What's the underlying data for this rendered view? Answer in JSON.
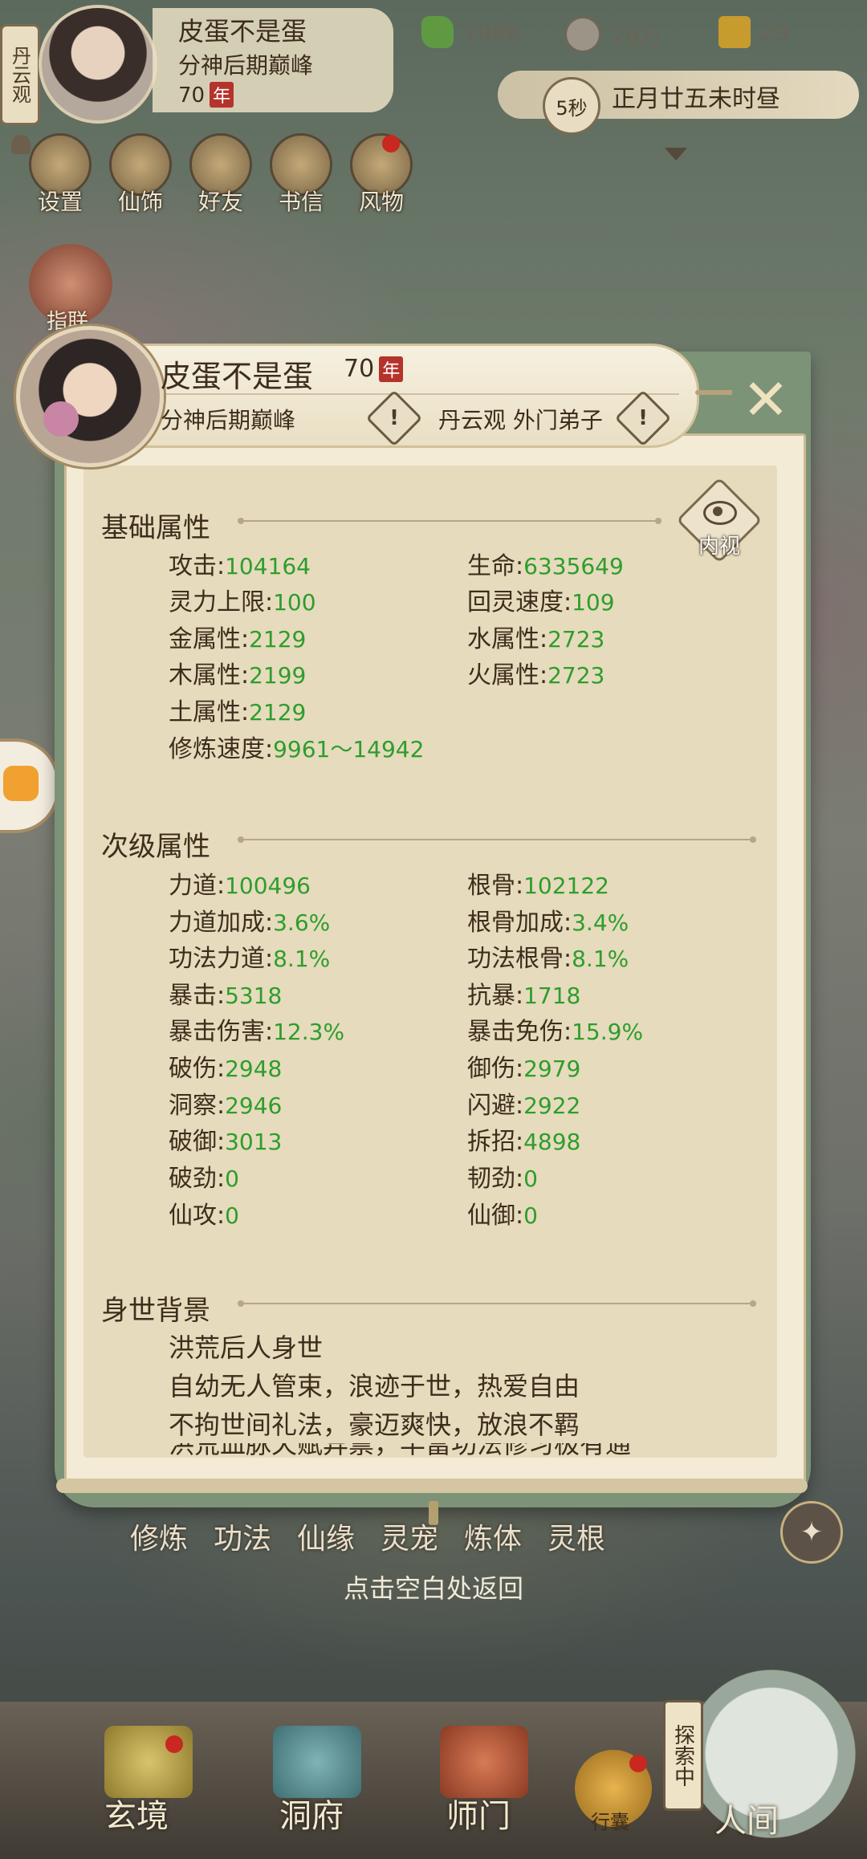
{
  "top": {
    "sect_short": "丹云观",
    "player_name": "皮蛋不是蛋",
    "realm": "分神后期巅峰",
    "age": "70",
    "age_unit": "年",
    "resources": [
      {
        "icon": "jade-leaf-icon",
        "value": "1086"
      },
      {
        "icon": "coin-icon",
        "value": "29万"
      },
      {
        "icon": "gold-cross-icon",
        "value": "29"
      }
    ],
    "timer": "5秒",
    "date": "正月廿五未时昼"
  },
  "menu": [
    "设置",
    "仙饰",
    "好友",
    "书信",
    "风物"
  ],
  "side_label": "指联",
  "panel": {
    "name": "皮蛋不是蛋",
    "age": "70",
    "age_unit": "年",
    "realm": "分神后期巅峰",
    "sect": "丹云观 外门弟子",
    "inner_view": "内视",
    "sections": {
      "basic": {
        "title": "基础属性",
        "left": [
          {
            "label": "攻击",
            "value": "104164"
          },
          {
            "label": "灵力上限",
            "value": "100"
          },
          {
            "label": "金属性",
            "value": "2129"
          },
          {
            "label": "木属性",
            "value": "2199"
          },
          {
            "label": "土属性",
            "value": "2129"
          },
          {
            "label": "修炼速度",
            "value": "9961～14942"
          }
        ],
        "right": [
          {
            "label": "生命",
            "value": "6335649"
          },
          {
            "label": "回灵速度",
            "value": "109"
          },
          {
            "label": "水属性",
            "value": "2723"
          },
          {
            "label": "火属性",
            "value": "2723"
          }
        ]
      },
      "secondary": {
        "title": "次级属性",
        "left": [
          {
            "label": "力道",
            "value": "100496"
          },
          {
            "label": "力道加成",
            "value": "3.6%"
          },
          {
            "label": "功法力道",
            "value": "8.1%"
          },
          {
            "label": "暴击",
            "value": "5318"
          },
          {
            "label": "暴击伤害",
            "value": "12.3%"
          },
          {
            "label": "破伤",
            "value": "2948"
          },
          {
            "label": "洞察",
            "value": "2946"
          },
          {
            "label": "破御",
            "value": "3013"
          },
          {
            "label": "破劲",
            "value": "0"
          },
          {
            "label": "仙攻",
            "value": "0"
          }
        ],
        "right": [
          {
            "label": "根骨",
            "value": "102122"
          },
          {
            "label": "根骨加成",
            "value": "3.4%"
          },
          {
            "label": "功法根骨",
            "value": "8.1%"
          },
          {
            "label": "抗暴",
            "value": "1718"
          },
          {
            "label": "暴击免伤",
            "value": "15.9%"
          },
          {
            "label": "御伤",
            "value": "2979"
          },
          {
            "label": "闪避",
            "value": "2922"
          },
          {
            "label": "拆招",
            "value": "4898"
          },
          {
            "label": "韧劲",
            "value": "0"
          },
          {
            "label": "仙御",
            "value": "0"
          }
        ]
      },
      "background": {
        "title": "身世背景",
        "lines": [
          "洪荒后人身世",
          "自幼无人管束，浪迹于世，热爱自由",
          "不拘世间礼法，豪迈爽快，放浪不羁",
          "洪荒血脉天赋异禀，丰富功法修习极有通"
        ]
      }
    }
  },
  "bottom_tabs": [
    "修炼",
    "功法",
    "仙缘",
    "灵宠",
    "炼体",
    "灵根"
  ],
  "return_hint": "点击空白处返回",
  "nav": {
    "items": [
      "玄境",
      "洞府",
      "师门"
    ],
    "bag": "行囊",
    "explore": "探索中",
    "world": "人间"
  }
}
